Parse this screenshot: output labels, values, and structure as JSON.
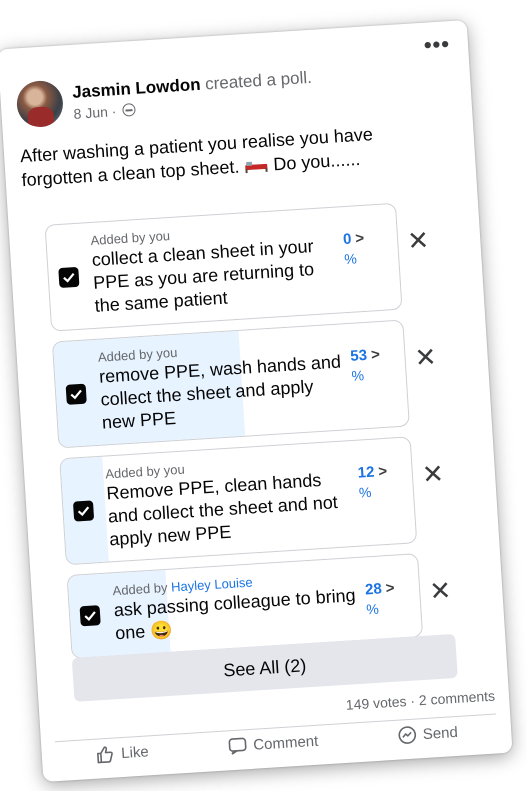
{
  "post": {
    "author": "Jasmin Lowdon",
    "action": "created a poll.",
    "date": "8 Jun · ",
    "audience_icon": "friends-icon",
    "more_label": "•••",
    "question": "After washing a patient you realise you have forgotten a clean top sheet.",
    "question_suffix": "Do you......"
  },
  "poll": {
    "options": [
      {
        "added_prefix": "Added by",
        "added_by": "you",
        "text": "collect a clean sheet in your PPE as you are returning to the same patient",
        "percent": "0",
        "percent_symbol": "%",
        "fill": 0,
        "checked": true
      },
      {
        "added_prefix": "Added by",
        "added_by": "you",
        "text": "remove PPE, wash hands and collect the sheet and apply new PPE",
        "percent": "53",
        "percent_symbol": "%",
        "fill": 0.53,
        "checked": true
      },
      {
        "added_prefix": "Added by",
        "added_by": "you",
        "text": "Remove PPE, clean hands and collect the sheet and not apply new PPE",
        "percent": "12",
        "percent_symbol": "%",
        "fill": 0.12,
        "checked": true
      },
      {
        "added_prefix": "Added by",
        "added_by": "Hayley Louise",
        "text": "ask passing colleague to bring one",
        "text_emoji": "😀",
        "percent": "28",
        "percent_symbol": "%",
        "fill": 0.28,
        "checked": true
      }
    ],
    "chevron": ">",
    "remove_label": "✕",
    "see_all_label": "See All (2)",
    "stats": "149 votes · 2 comments"
  },
  "actions": {
    "like": "Like",
    "comment": "Comment",
    "send": "Send"
  },
  "colors": {
    "accent": "#1b74e4",
    "fill": "#e7f3ff",
    "see_all_bg": "#e4e6eb"
  }
}
